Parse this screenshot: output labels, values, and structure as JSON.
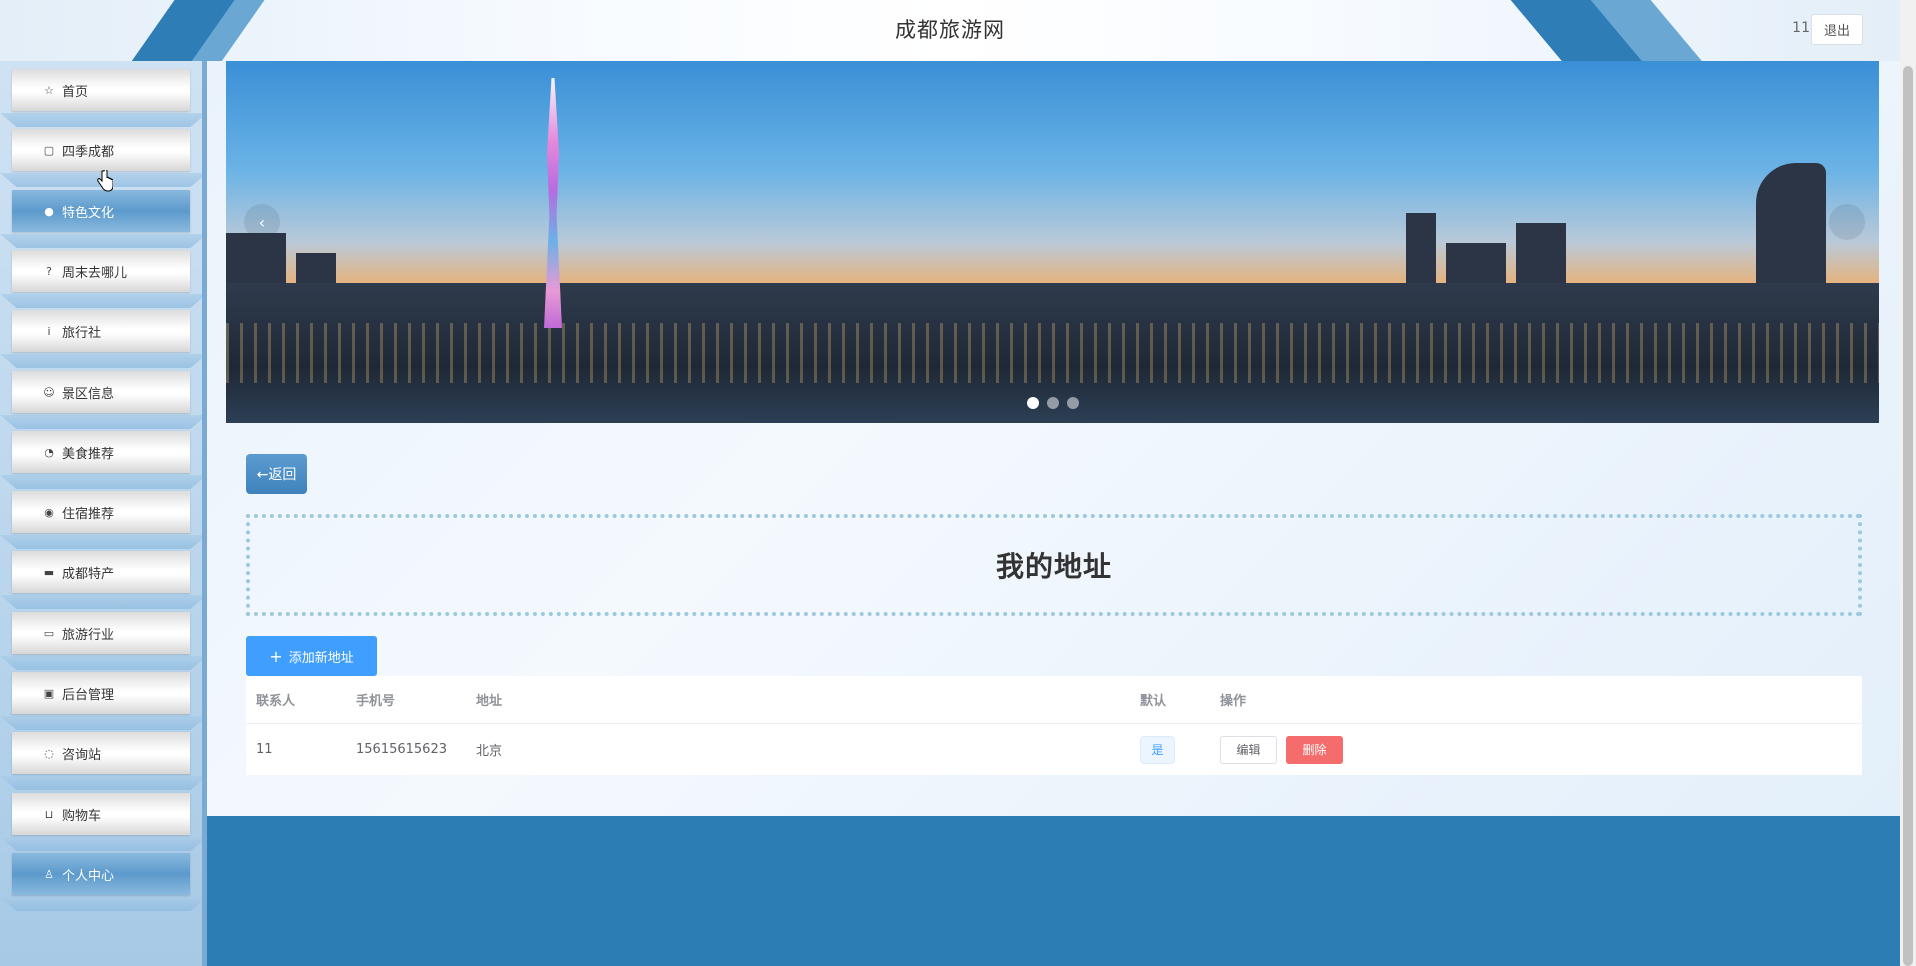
{
  "header": {
    "site_title": "成都旅游网",
    "username": "11",
    "logout_label": "退出"
  },
  "sidebar": {
    "items": [
      {
        "label": "首页",
        "icon": "star-icon",
        "glyph": "☆",
        "active": false
      },
      {
        "label": "四季成都",
        "icon": "bag-icon",
        "glyph": "▢",
        "active": false
      },
      {
        "label": "特色文化",
        "icon": "info-circle-icon",
        "glyph": "●",
        "active": true
      },
      {
        "label": "周末去哪儿",
        "icon": "question-circle-icon",
        "glyph": "?",
        "active": false
      },
      {
        "label": "旅行社",
        "icon": "info-icon",
        "glyph": "i",
        "active": false
      },
      {
        "label": "景区信息",
        "icon": "smile-icon",
        "glyph": "☺",
        "active": false
      },
      {
        "label": "美食推荐",
        "icon": "sunrise-icon",
        "glyph": "◔",
        "active": false
      },
      {
        "label": "住宿推荐",
        "icon": "camera-icon",
        "glyph": "◉",
        "active": false
      },
      {
        "label": "成都特产",
        "icon": "car-icon",
        "glyph": "▬",
        "active": false
      },
      {
        "label": "旅游行业",
        "icon": "folder-icon",
        "glyph": "▭",
        "active": false
      },
      {
        "label": "后台管理",
        "icon": "briefcase-icon",
        "glyph": "▣",
        "active": false
      },
      {
        "label": "咨询站",
        "icon": "headset-icon",
        "glyph": "◌",
        "active": false
      },
      {
        "label": "购物车",
        "icon": "cart-icon",
        "glyph": "⊔",
        "active": false
      },
      {
        "label": "个人中心",
        "icon": "user-icon",
        "glyph": "♙",
        "active": true
      }
    ]
  },
  "carousel": {
    "prev_label": "‹",
    "slide_count": 3,
    "current_slide": 1
  },
  "main": {
    "back_label": "←返回",
    "page_title": "我的地址",
    "add_label": "添加新地址"
  },
  "address_table": {
    "columns": [
      "联系人",
      "手机号",
      "地址",
      "默认",
      "操作"
    ],
    "rows": [
      {
        "contact": "11",
        "phone": "15615615623",
        "address": "北京",
        "default": "是",
        "edit_label": "编辑",
        "delete_label": "删除"
      }
    ]
  },
  "colors": {
    "primary": "#409eff",
    "danger": "#f56c6c",
    "brand_blue": "#2b7db3"
  }
}
